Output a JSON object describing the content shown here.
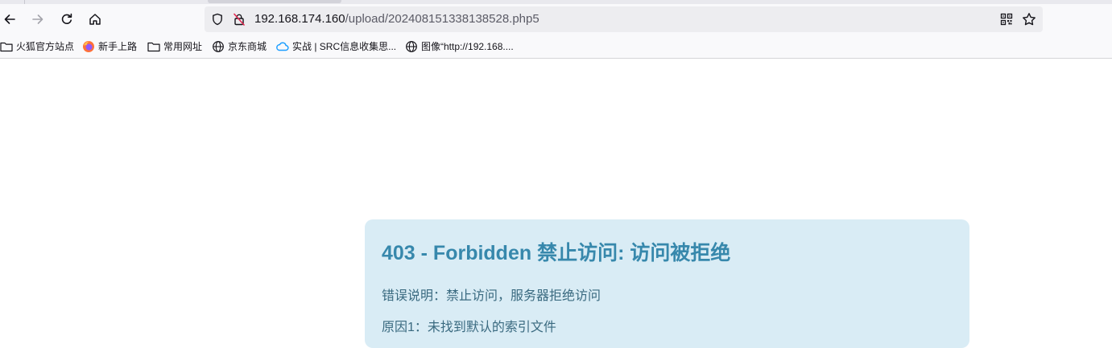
{
  "browser": {
    "url_host": "192.168.174.160",
    "url_path": "/upload/202408151338138528.php5"
  },
  "bookmarks": [
    {
      "label": "火狐官方站点",
      "icon": "folder-icon"
    },
    {
      "label": "新手上路",
      "icon": "firefox-icon"
    },
    {
      "label": "常用网址",
      "icon": "folder-icon"
    },
    {
      "label": "京东商城",
      "icon": "globe-icon"
    },
    {
      "label": "实战 | SRC信息收集思...",
      "icon": "cloud-icon"
    },
    {
      "label": "图像“http://192.168....",
      "icon": "globe-icon"
    }
  ],
  "page": {
    "title": "403 - Forbidden 禁止访问: 访问被拒绝",
    "description": "错误说明：禁止访问，服务器拒绝访问",
    "reason_1": "原因1：未找到默认的索引文件"
  },
  "colors": {
    "box_bg": "#d9ecf5",
    "title": "#3788ac",
    "text": "#3a6a80"
  }
}
